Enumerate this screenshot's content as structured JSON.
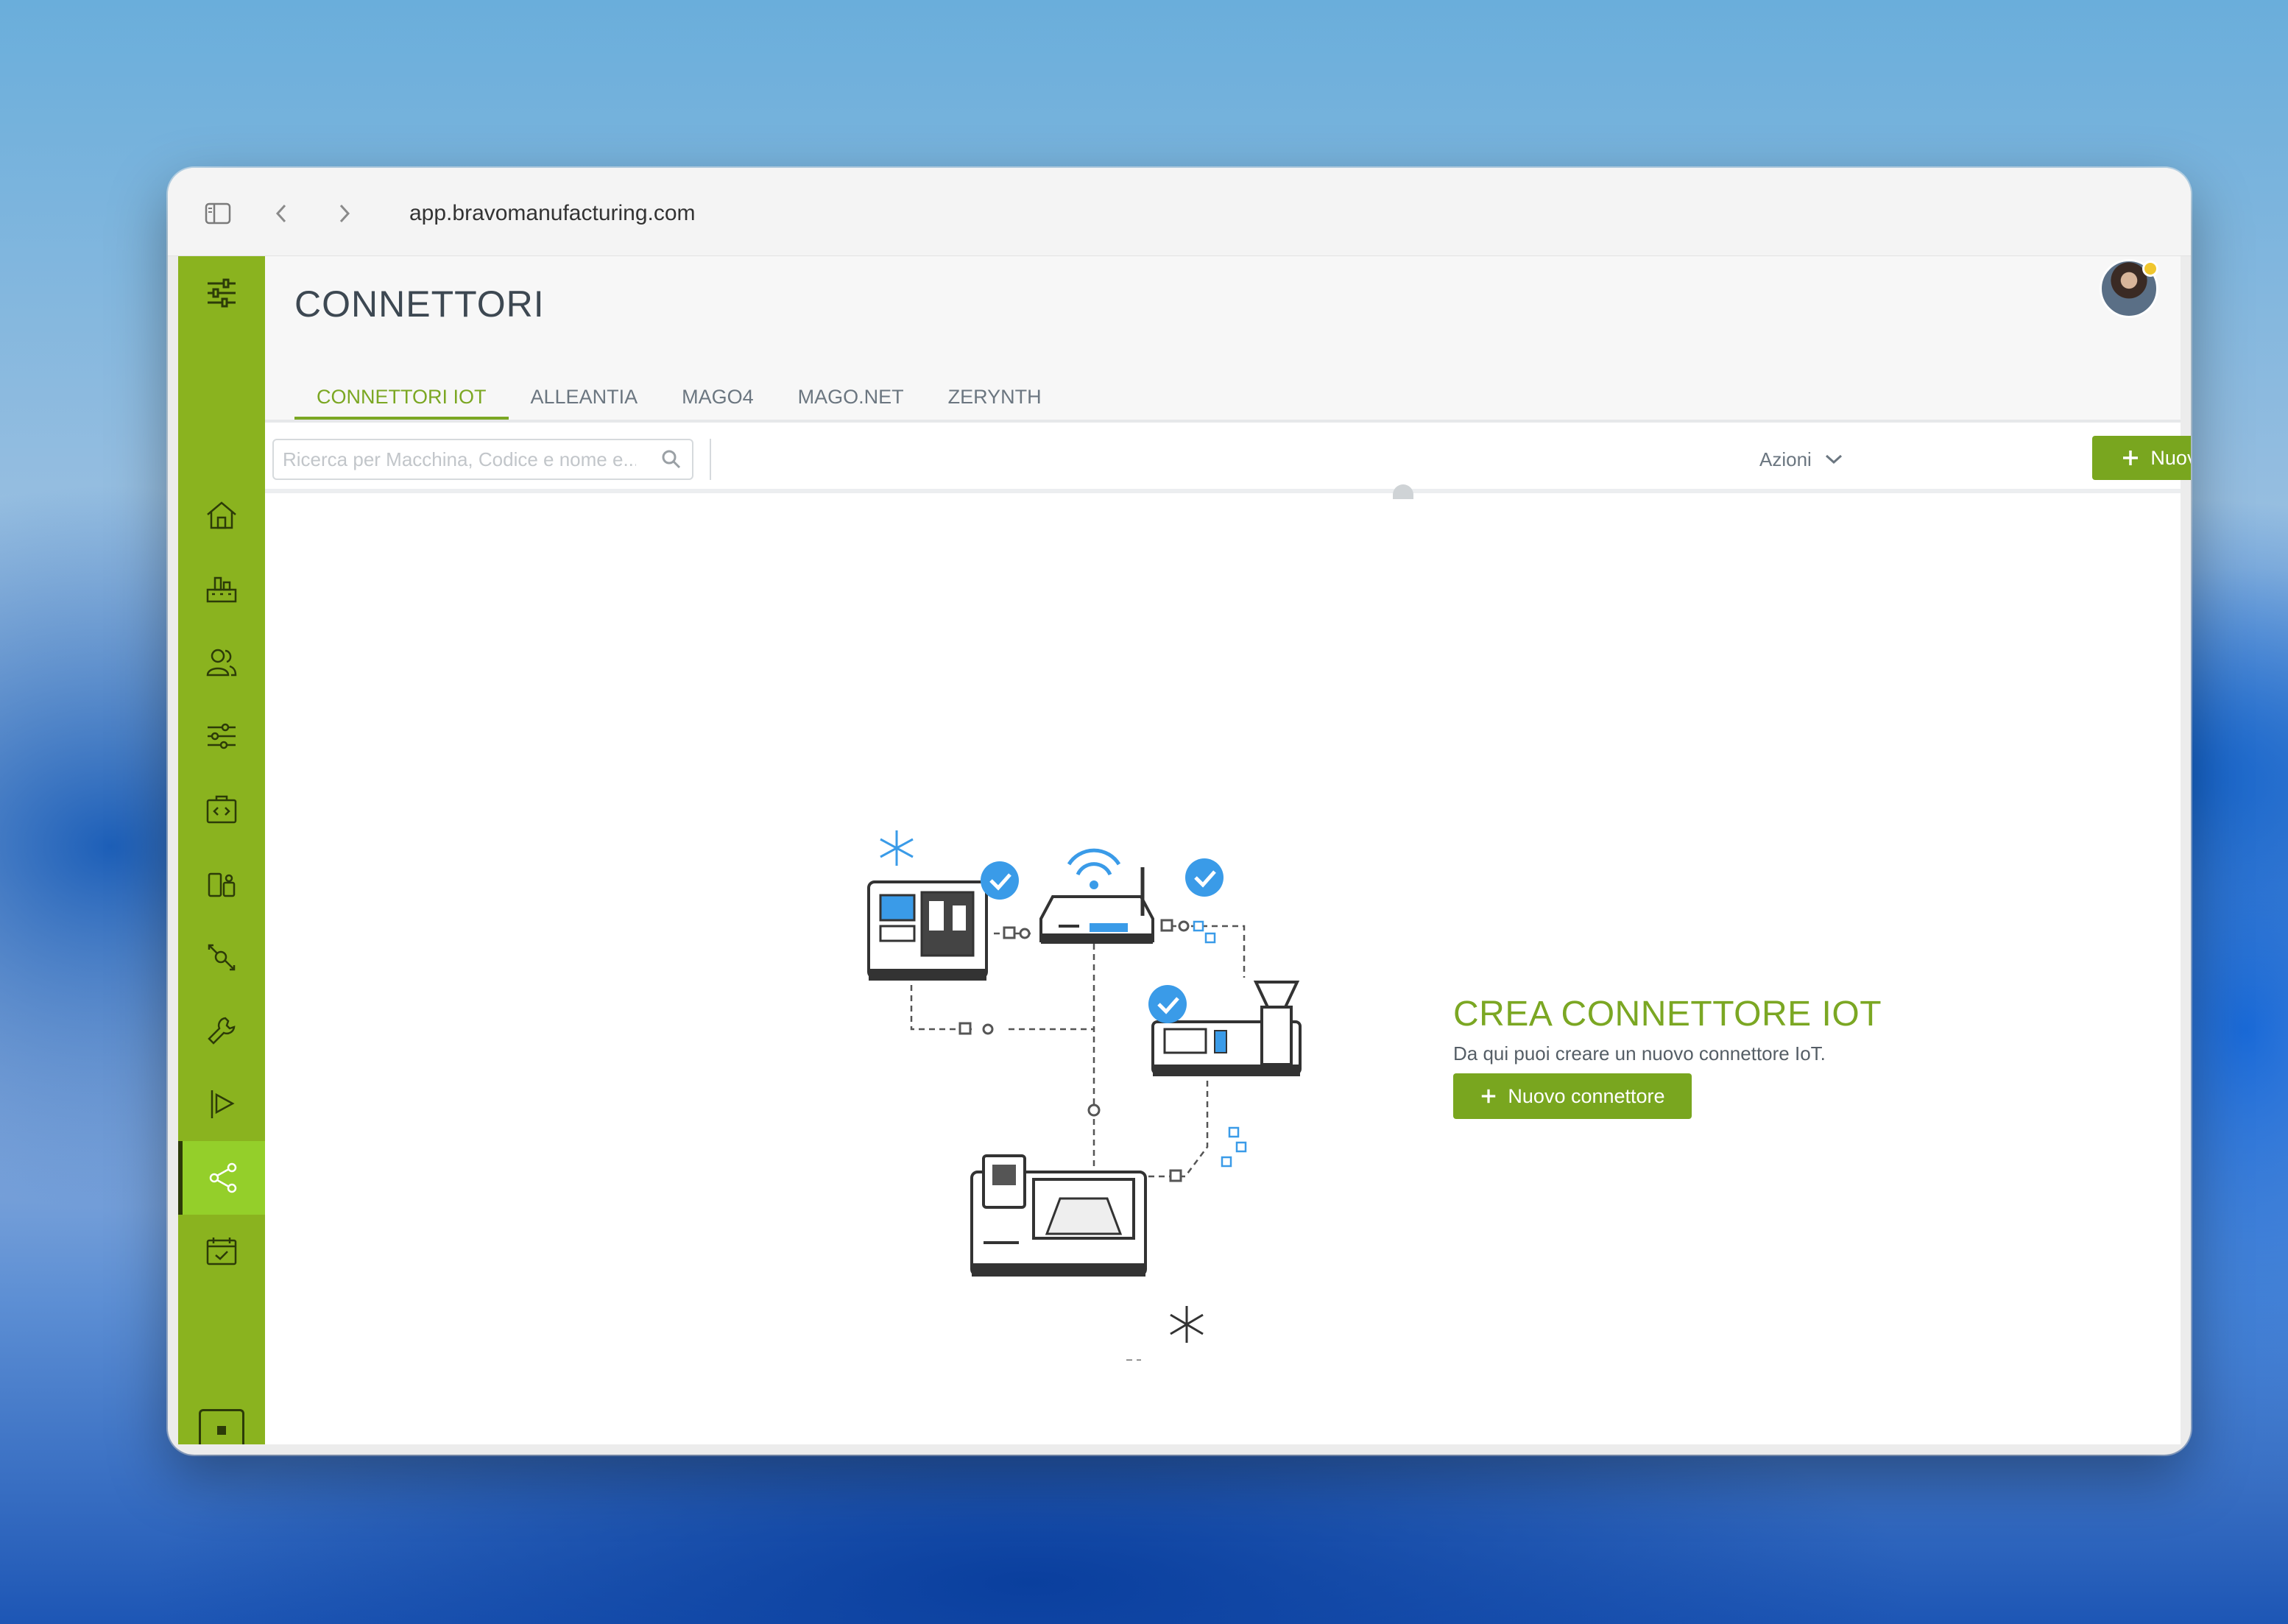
{
  "browser": {
    "url": "app.bravomanufacturing.com"
  },
  "page": {
    "title": "CONNETTORI"
  },
  "tabs": [
    {
      "label": "CONNETTORI IOT",
      "active": true
    },
    {
      "label": "ALLEANTIA",
      "active": false
    },
    {
      "label": "MAGO4",
      "active": false
    },
    {
      "label": "MAGO.NET",
      "active": false
    },
    {
      "label": "ZERYNTH",
      "active": false
    }
  ],
  "toolbar": {
    "search_placeholder": "Ricerca per Macchina, Codice e nome e...",
    "actions_label": "Azioni",
    "new_connector_label": "Nuovo connettore"
  },
  "empty_state": {
    "title": "CREA CONNETTORE IOT",
    "subtitle": "Da qui puoi creare un nuovo connettore IoT.",
    "button_label": "Nuovo connettore"
  },
  "sidebar": {
    "items": [
      {
        "icon": "sliders-icon",
        "active": false
      },
      {
        "icon": "home-icon",
        "active": false
      },
      {
        "icon": "factory-icon",
        "active": false
      },
      {
        "icon": "users-icon",
        "active": false
      },
      {
        "icon": "settings-sliders-icon",
        "active": false
      },
      {
        "icon": "code-briefcase-icon",
        "active": false
      },
      {
        "icon": "devices-icon",
        "active": false
      },
      {
        "icon": "workflow-icon",
        "active": false
      },
      {
        "icon": "wrench-icon",
        "active": false
      },
      {
        "icon": "play-flag-icon",
        "active": false
      },
      {
        "icon": "share-icon",
        "active": true
      },
      {
        "icon": "calendar-check-icon",
        "active": false
      }
    ]
  },
  "colors": {
    "brand_green": "#8ab31f",
    "active_green": "#94cf2a",
    "button_green": "#79a61f",
    "accent_blue": "#3a9be8"
  }
}
